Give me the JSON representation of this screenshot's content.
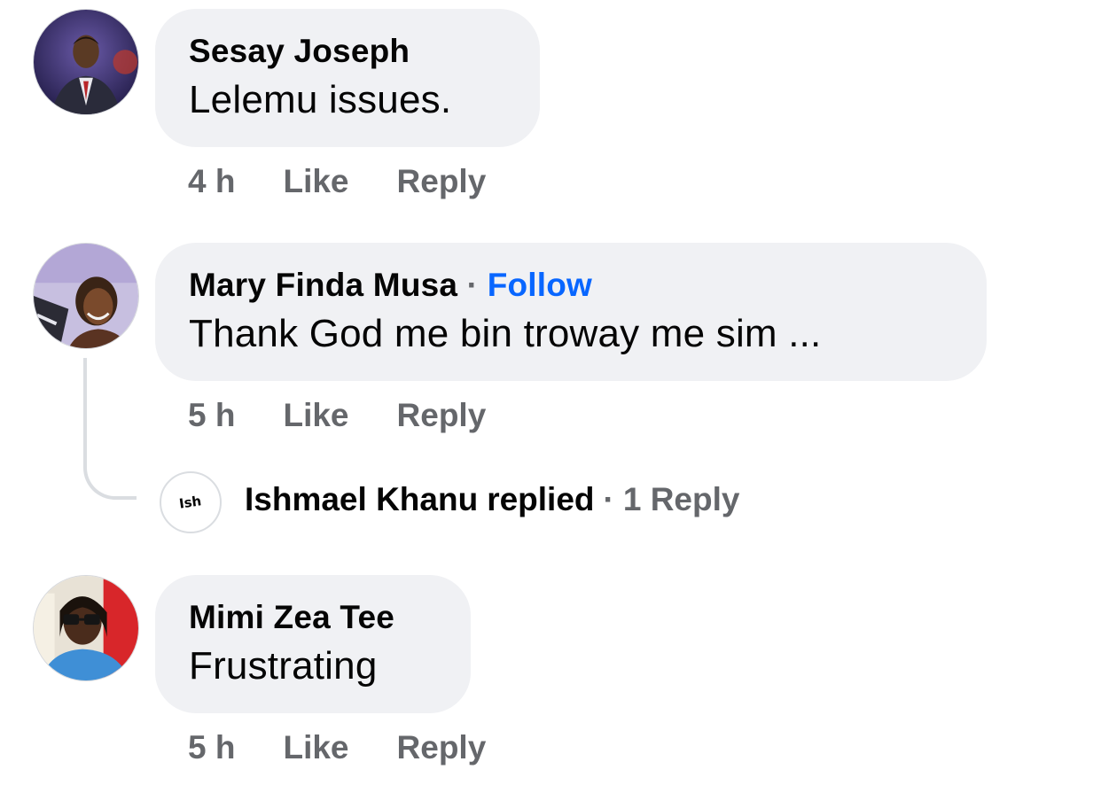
{
  "comments": [
    {
      "author": "Sesay Joseph",
      "text": "Lelemu issues.",
      "time": "4 h",
      "like_label": "Like",
      "reply_label": "Reply"
    },
    {
      "author": "Mary Finda Musa",
      "separator": "·",
      "follow_label": "Follow",
      "text": "Thank God me bin troway me sim ...",
      "time": "5 h",
      "like_label": "Like",
      "reply_label": "Reply",
      "replies_summary": {
        "avatar_text": "Ish",
        "name": "Ishmael Khanu",
        "verb": "replied",
        "separator": "·",
        "count_label": "1 Reply"
      }
    },
    {
      "author": "Mimi Zea Tee",
      "text": "Frustrating",
      "time": "5 h",
      "like_label": "Like",
      "reply_label": "Reply"
    }
  ],
  "colors": {
    "bubble": "#f0f1f4",
    "meta_text": "#65676b",
    "follow_link": "#0866ff",
    "thread_line": "#dadde1"
  }
}
